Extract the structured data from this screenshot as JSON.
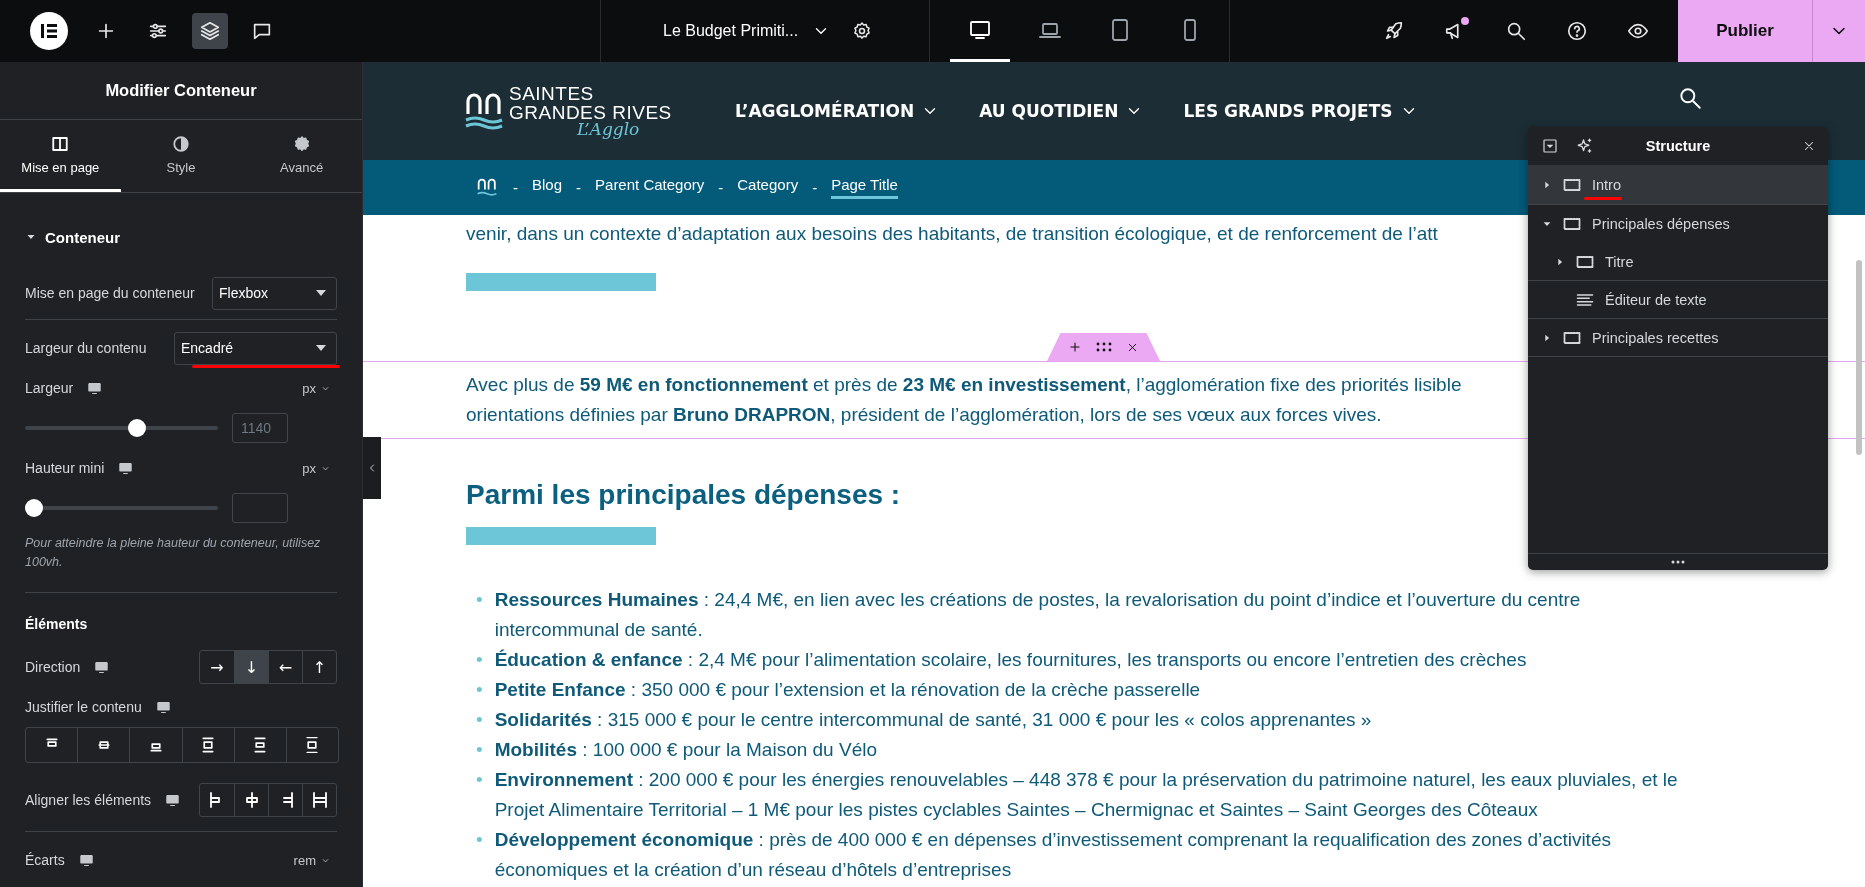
{
  "topbar": {
    "tools": [
      {
        "kind": "add",
        "selected": false
      },
      {
        "kind": "settings",
        "selected": false
      },
      {
        "kind": "layers",
        "selected": true
      },
      {
        "kind": "comments",
        "selected": false
      }
    ],
    "document_title": "Le Budget Primiti...",
    "devices": [
      {
        "kind": "desktop",
        "selected": true
      },
      {
        "kind": "laptop",
        "selected": false
      },
      {
        "kind": "tablet",
        "selected": false
      },
      {
        "kind": "phone",
        "selected": false
      }
    ],
    "actions": [
      {
        "kind": "rocket",
        "notification": false
      },
      {
        "kind": "megaphone",
        "notification": true
      },
      {
        "kind": "search",
        "notification": false
      },
      {
        "kind": "help",
        "notification": false
      },
      {
        "kind": "preview",
        "notification": false
      }
    ],
    "publish_button": "Publier"
  },
  "panel": {
    "title": "Modifier Conteneur",
    "tabs": [
      {
        "label": "Mise en page",
        "selected": true
      },
      {
        "label": "Style",
        "selected": false
      },
      {
        "label": "Avancé",
        "selected": false
      }
    ],
    "section": {
      "title": "Conteneur",
      "expanded": true
    },
    "rows": [
      {
        "kind": "select",
        "label": "Mise en page du conteneur",
        "value": "Flexbox",
        "annotated": false,
        "responsive": false
      },
      {
        "kind": "divider"
      },
      {
        "kind": "select",
        "label": "Largeur du contenu",
        "value": "Encadré",
        "annotated": true,
        "responsive": false
      },
      {
        "kind": "slider",
        "label": "Largeur",
        "unit": "px",
        "level": 0.58,
        "placeholder": "1140",
        "responsive": true
      },
      {
        "kind": "slider",
        "label": "Hauteur mini",
        "unit": "px",
        "level": 0,
        "responsive": true
      },
      {
        "kind": "note",
        "text": "Pour atteindre la pleine hauteur du conteneur, utilisez 100vh."
      },
      {
        "kind": "divider"
      },
      {
        "kind": "heading",
        "text": "Éléments"
      },
      {
        "kind": "choices",
        "label": "Direction",
        "responsive": true,
        "options": [
          {
            "glyph": "→",
            "selected": false
          },
          {
            "glyph": "↓",
            "selected": true
          },
          {
            "glyph": "←",
            "selected": false
          },
          {
            "glyph": "↑",
            "selected": false
          }
        ]
      },
      {
        "kind": "justify",
        "label": "Justifier le contenu",
        "responsive": true,
        "options": [
          {
            "selected": false
          },
          {
            "selected": false
          },
          {
            "selected": false
          },
          {
            "selected": false
          },
          {
            "selected": false
          },
          {
            "selected": false
          }
        ]
      },
      {
        "kind": "align",
        "label": "Aligner les éléments",
        "responsive": true,
        "options": [
          {
            "selected": false
          },
          {
            "selected": false
          },
          {
            "selected": false
          },
          {
            "selected": false
          }
        ]
      },
      {
        "kind": "divider"
      },
      {
        "kind": "unit",
        "label": "Écarts",
        "unit": "rem",
        "responsive": true
      }
    ]
  },
  "site": {
    "logo": {
      "line_1": "SAINTES",
      "line_2": "GRANDES RIVES",
      "tagline": "L’Agglo"
    },
    "nav": [
      "L’AGGLOMÉRATION",
      "AU QUOTIDIEN",
      "LES GRANDS PROJETS"
    ],
    "breadcrumb": [
      {
        "label": "Blog",
        "current": false
      },
      {
        "label": "Parent Category",
        "current": false
      },
      {
        "label": "Category",
        "current": false
      },
      {
        "label": "Page Title",
        "current": true
      }
    ],
    "breadcrumb_separator": "-"
  },
  "content": {
    "intro_line": "venir, dans un contexte d’adaptation aux besoins des habitants, de transition écologique, et de renforcement de l’att",
    "selected_container": {
      "selected": true,
      "lines": [
        "Avec plus de **59 M€ en fonctionnement** et près de **23 M€ en investissement**, l’agglomération fixe des priorités lisible",
        "orientations définies par **Bruno DRAPRON**, président de l’agglomération, lors de ses vœux aux forces vives."
      ]
    },
    "heading": "Parmi les principales dépenses :",
    "list": [
      {
        "marker": "•",
        "term": "Ressources Humaines",
        "text": " : 24,4 M€, en lien avec les créations de postes, la revalorisation du point d’indice et l’ouverture du centre intercommunal de santé."
      },
      {
        "marker": "•",
        "term": "Éducation & enfance",
        "text": " : 2,4 M€ pour l’alimentation scolaire, les fournitures, les transports ou encore l’entretien des crèches"
      },
      {
        "marker": "•",
        "term": "Petite Enfance",
        "text": " : 350 000 € pour l’extension et la rénovation de la crèche passerelle"
      },
      {
        "marker": "•",
        "term": "Solidarités",
        "text": " : 315 000 € pour le centre intercommunal de santé, 31 000 € pour les « colos apprenantes »"
      },
      {
        "marker": "•",
        "term": "Mobilités",
        "text": " : 100 000 € pour la Maison du Vélo"
      },
      {
        "marker": "•",
        "term": "Environnement",
        "text": " : 200 000 € pour les énergies renouvelables – 448 378 € pour la préservation du patrimoine naturel, les eaux pluviales, et le Projet Alimentaire Territorial – 1 M€ pour les pistes cyclables Saintes – Chermignac et Saintes – Saint Georges des Côteaux"
      },
      {
        "marker": "•",
        "term": "Développement économique",
        "text": " : près de 400 000 € en dépenses d’investissement comprenant la requalification des zones d’activités économiques et la création d’un réseau d’hôtels d’entreprises"
      }
    ]
  },
  "structure": {
    "title": "Structure",
    "items": [
      {
        "kind": "container",
        "label": "Intro",
        "expanded": false,
        "selected": true,
        "annotated": true
      },
      {
        "kind": "container",
        "label": "Principales dépenses",
        "expanded": true,
        "selected": false,
        "annotated": false,
        "children": [
          {
            "kind": "container",
            "label": "Titre",
            "expanded": false,
            "selected": false,
            "annotated": false
          },
          {
            "kind": "text",
            "label": "Éditeur de texte",
            "selected": false,
            "annotated": false
          }
        ]
      },
      {
        "kind": "container",
        "label": "Principales recettes",
        "expanded": false,
        "selected": false,
        "annotated": false
      }
    ]
  }
}
